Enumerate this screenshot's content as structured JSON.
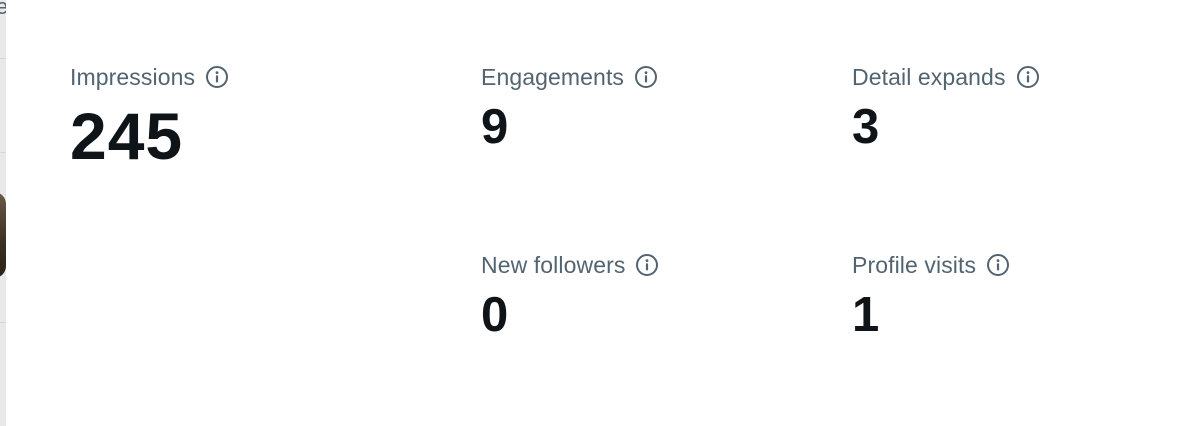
{
  "edge": {
    "partial_char": "e"
  },
  "metrics": {
    "impressions": {
      "label": "Impressions",
      "value": "245",
      "icon": "info-icon"
    },
    "engagements": {
      "label": "Engagements",
      "value": "9",
      "icon": "info-icon"
    },
    "detail_expands": {
      "label": "Detail expands",
      "value": "3",
      "icon": "info-icon"
    },
    "new_followers": {
      "label": "New followers",
      "value": "0",
      "icon": "info-icon"
    },
    "profile_visits": {
      "label": "Profile visits",
      "value": "1",
      "icon": "info-icon"
    }
  },
  "colors": {
    "label": "#536471",
    "value": "#0f1419",
    "background": "#ffffff"
  }
}
